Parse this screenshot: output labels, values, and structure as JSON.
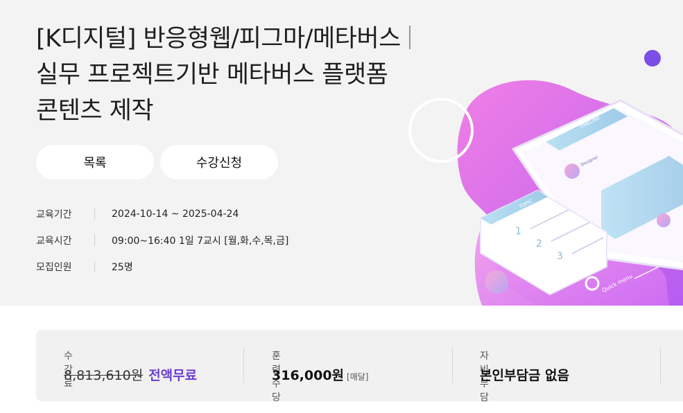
{
  "course": {
    "title_line1": "[K디지털] 반응형웹/피그마/메타버스",
    "title_line2": "실무 프로젝트기반 메타버스 플랫폼",
    "title_line3": "콘텐츠 제작"
  },
  "buttons": {
    "list_label": "목록",
    "apply_label": "수강신청"
  },
  "info": [
    {
      "label": "교육기간",
      "value": "2024-10-14 ~ 2025-04-24"
    },
    {
      "label": "교육시간",
      "value": "09:00~16:40 1일 7교시 [월,화,수,목,금]"
    },
    {
      "label": "모집인원",
      "value": "25명"
    }
  ],
  "illustration": {
    "timeline_label": "TIMELINE",
    "topic_label": "TOPIC",
    "designer_label": "Designer",
    "quick_menu_label": "Quick menu",
    "steps": [
      "1",
      "2",
      "3"
    ],
    "colors": {
      "pink": "#e873e0",
      "purple": "#c46ef0",
      "violet": "#7b4fe6",
      "sky": "#a7d4ef"
    }
  },
  "summary": {
    "tuition_label": "수강료",
    "tuition_original": "8,813,610원",
    "tuition_free": "전액무료",
    "allowance_label": "훈련수당",
    "allowance_value": "316,000원",
    "allowance_unit": "[매달]",
    "self_pay_label": "자비부담",
    "self_pay_value": "본인부담금 없음"
  },
  "colors": {
    "accent": "#6a3fd1",
    "hero_bg": "#f3f3f3",
    "summary_bg": "#f1f1f1"
  }
}
